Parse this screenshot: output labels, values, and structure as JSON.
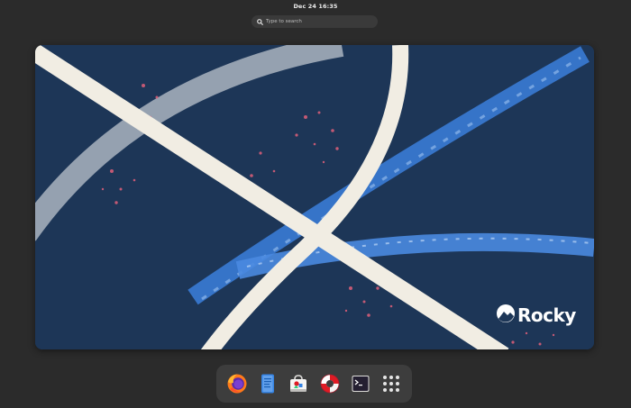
{
  "topbar": {
    "clock": "Dec 24  16:35"
  },
  "search": {
    "placeholder": "Type to search",
    "icon": "search-icon"
  },
  "wallpaper": {
    "logo_text": "Rocky",
    "colors": {
      "background": "#1d3657",
      "stripe": "#f1ede3",
      "gray_stripe": "#aab4bf",
      "blue_stripe": "#3a7bd5",
      "accent_pink": "#e0607a"
    }
  },
  "dock": {
    "items": [
      {
        "name": "Firefox",
        "icon": "firefox-icon"
      },
      {
        "name": "Text Editor",
        "icon": "text-editor-icon"
      },
      {
        "name": "Software",
        "icon": "software-icon"
      },
      {
        "name": "Help",
        "icon": "help-lifebuoy-icon"
      },
      {
        "name": "Terminal",
        "icon": "terminal-icon"
      },
      {
        "name": "Show Applications",
        "icon": "app-grid-icon"
      }
    ]
  }
}
